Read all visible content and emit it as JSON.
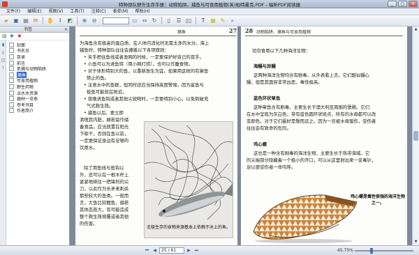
{
  "window": {
    "title": "特种部队野外生存手册：动物陷阱、捕鱼与可食用植物(英)柏特曼克.PDF - 福昕PDF阅读器",
    "controls": [
      "_",
      "□",
      "×"
    ]
  },
  "menu": [
    "文件(F)",
    "编辑(E)",
    "视图(V)",
    "工具(T)",
    "注释(C)",
    "表单(M)",
    "帮助(H)"
  ],
  "toolbar": {
    "icons": [
      "open-icon",
      "save-icon",
      "print-icon",
      "email-icon",
      "hand-tool-icon",
      "select-text-icon",
      "snapshot-icon",
      "zoom-in-icon",
      "zoom-out-icon",
      "fit-page-icon",
      "fit-width-icon",
      "rotate-icon",
      "single-page-icon",
      "continuous-icon",
      "facing-icon",
      "typewriter-icon",
      "note-icon",
      "highlight-icon",
      "search-icon"
    ],
    "zoom_value": ""
  },
  "sidebar": {
    "header": "书签",
    "items": [
      {
        "label": "封面",
        "selected": false
      },
      {
        "label": "书名页",
        "selected": false
      },
      {
        "label": "目录",
        "selected": false
      },
      {
        "label": "前言",
        "selected": false
      },
      {
        "label": "抓捕与动物陷阱",
        "selected": false
      },
      {
        "label": "捕鱼",
        "selected": true
      },
      {
        "label": "可食用植物",
        "selected": false
      },
      {
        "label": "野生药物",
        "selected": false
      },
      {
        "label": "淡水水资源",
        "selected": false
      },
      {
        "label": "器材一览表",
        "selected": false
      },
      {
        "label": "参考书目",
        "selected": false
      },
      {
        "label": "作者简介",
        "selected": false
      }
    ]
  },
  "page_left": {
    "header": "捕鱼",
    "page_number": "27",
    "lines": [
      "为海鱼含有极高的蛋白质，在人体内消化时无需太多的水分。海上",
      "捕鱼时，特种部队往往会遵循以下各项原则：",
      "• 未手把住鱼线或者渔网的时候，一定要保护好自己的双手。",
      "• 小鱼可以为诱鱼饵（用小网打捞）。也可以作腹食物。",
      "• 对于体形特别大的鱼，以重新放生为宜。如果用这样的有窜鱼",
      "禁止的鱼。",
      "• 注意水中的鱼群，但同时还应当保持高度警惕，因为鲨鱼与",
      "梭鱼可能就在附近。",
      "• 夜晚诱鱼钩或者其他尖锐物时，一定要特别小心，以免刺破充",
      "气式救生筏。",
      "• 捕鱼以后，要立即",
      "清理其内脏，摘若留作储",
      "备食品，应当放置在阳光",
      "下晾干，否则在鱼以前，",
      "一定要保证身边有足够的",
      "饮用水。",
      "",
      "除了用鱼线与鱼钩以",
      "外，还可以在一根木杆上",
      "紧紧地绑住一把锋利的尖",
      "刀，以此作为长矛来刺杀",
      "那些较大的鱼类。一般而",
      "言，大鱼比较鲤鱼，偏若",
      "其体态庞大，有可能造成",
      "整个救生筏倾覆或者其他",
      "的伤害。"
    ],
    "photo_caption": "北极生存的食物来源基本上依赖于冰上的鱼。"
  },
  "page_right": {
    "page_number": "28",
    "header": "动物陷阱、捕鱼与可食用植物",
    "intro": "切勿食用以下几种海洋生物：",
    "sections": [
      {
        "title": "海鳗与异鳗",
        "lines": [
          "这两种海洋生物均含有剧毒，从外表看上去，它们酷似鳗心",
          "鳗，但是其面容非常凶恶，毒性极高。"
        ]
      },
      {
        "title": "蓝色环状章鱼",
        "lines": [
          "这种章鱼含有剧毒，主要生长于澳大利亚周围的堡礁。它们",
          "在水中呈现为灰白色，带有蓝色圆环状斑点，所有的水母都可以改",
          "变颜色，对于它们最好是敬而远之，因为一旦被水母蛰伤，受伤者",
          "往往会有致命的危险。"
        ]
      },
      {
        "title": "鸡心螺",
        "lines": [
          "这也是一种含有剧毒的海洋生物，主要生长于热带海域。它",
          "的尖端部分隐藏着一个极小的开口，可以从这里射出来一支毒针，",
          "足以使受伤者一命呜呼。"
        ]
      }
    ],
    "photo_caption": "鸡心螺是毒性很强的海洋生物之一。"
  },
  "statusbar": {
    "page_input": "25 / 61",
    "zoom": "45.75%"
  },
  "colors": {
    "selection": "#316ac5",
    "viewer_bg": "#7d8a99"
  }
}
